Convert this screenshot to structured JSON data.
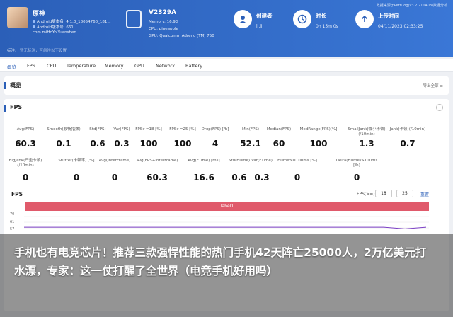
{
  "header": {
    "note": "数据来源于PerfDog(v3.2.210408)数据分析",
    "app": {
      "name": "原神",
      "line1": "Android版本名: 4.1.0_18054760_181...",
      "line2": "Android版本号: 661",
      "line3": "com.miHoYo.Yuanshen"
    },
    "device": {
      "name": "V2329A",
      "memory": "Memory: 16.9G",
      "cpu": "CPU: pineapple",
      "gpu": "GPU: Qualcomm Adreno (TM) 750"
    },
    "creator": {
      "label": "创建者",
      "value": "ll.li"
    },
    "duration": {
      "label": "时长",
      "value": "0h 15m 0s"
    },
    "upload": {
      "label": "上传时间",
      "value": "04/11/2023 02:33:25"
    },
    "tag_label": "标注:",
    "tag_hint": "暂无标注，可前往以下设置"
  },
  "nav": [
    "概览",
    "FPS",
    "CPU",
    "Temperature",
    "Memory",
    "GPU",
    "Network",
    "Battery"
  ],
  "overview": {
    "title": "概览",
    "link": "导出全部 ≡"
  },
  "fps_panel": {
    "title": "FPS",
    "metrics_row1": [
      {
        "label": "Avg(FPS)",
        "value": "60.3"
      },
      {
        "label": "Smooth(顺畅指数)",
        "value": "0.1"
      },
      {
        "label": "Std(FPS)",
        "value": "0.6"
      },
      {
        "label": "Var(FPS)",
        "value": "0.3"
      },
      {
        "label": "FPS>=18 [%]",
        "value": "100"
      },
      {
        "label": "FPS>=25 [%]",
        "value": "100"
      },
      {
        "label": "Drop(FPS) [/h]",
        "value": "4"
      },
      {
        "label": "Min(FPS)",
        "value": "52.1"
      },
      {
        "label": "Median(FPS)",
        "value": "60"
      },
      {
        "label": "MedRange(FPS)[%]",
        "value": "100"
      },
      {
        "label": "SmallJank(微小卡顿)(/10min)",
        "value": "1.3"
      },
      {
        "label": "Jank(卡顿)(/10min)",
        "value": "0.7"
      }
    ],
    "metrics_row2": [
      {
        "label": "BigJank(严重卡顿)(/10min)",
        "value": "0"
      },
      {
        "label": "Stutter(卡顿率) [%]",
        "value": "0"
      },
      {
        "label": "Avg(InterFrame)",
        "value": "0"
      },
      {
        "label": "Avg(FPS+InterFrame)",
        "value": "60.3"
      },
      {
        "label": "Avg(FTime) [ms]",
        "value": "16.6"
      },
      {
        "label": "Std(FTime)",
        "value": "0.6"
      },
      {
        "label": "Var(FTime)",
        "value": "0.3"
      },
      {
        "label": "FTime>=100ms [%]",
        "value": "0"
      },
      {
        "label": "Delta(FTime)>100ms [/h]",
        "value": "0"
      }
    ]
  },
  "chart": {
    "title": "FPS",
    "ctrl_label": "FPS(>=)",
    "input1": "18",
    "input2": "25",
    "reset": "重置",
    "label_bar": "label1",
    "y_ticks": [
      "70",
      "61",
      "57"
    ]
  },
  "chart_data": {
    "type": "line",
    "title": "FPS",
    "xlabel": "",
    "ylabel": "",
    "ylim": [
      57,
      70
    ],
    "series": [
      {
        "values": [
          60,
          60,
          60,
          60,
          60,
          60,
          60,
          60,
          60,
          60,
          60,
          60,
          60,
          60,
          60,
          60,
          60,
          60,
          59,
          60
        ]
      }
    ]
  },
  "caption": "手机也有电竞芯片！推荐三款强悍性能的热门手机42天阵亡25000人，2万亿美元打水漂，专家：这一仗打醒了全世界（电竞手机好用吗）",
  "colors": {
    "header": "#2b5fb8",
    "label_bar": "#e05a6b",
    "line": "#7b3fc4"
  }
}
